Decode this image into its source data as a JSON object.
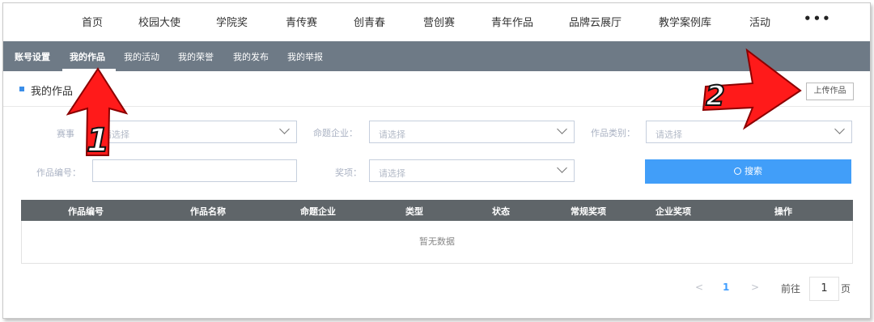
{
  "topnav": {
    "items": [
      "首页",
      "校园大使",
      "学院奖",
      "青传赛",
      "创青春",
      "营创赛",
      "青年作品",
      "品牌云展厅",
      "教学案例库",
      "活动"
    ],
    "more": "•••"
  },
  "subnav": {
    "items": [
      "账号设置",
      "我的作品",
      "我的活动",
      "我的荣誉",
      "我的发布",
      "我的举报"
    ],
    "active": "我的作品"
  },
  "section": {
    "title": "我的作品",
    "upload_label": "上传作品"
  },
  "filters": {
    "contest_label": "赛事",
    "contest_placeholder": "请选择",
    "company_label": "命题企业：",
    "company_placeholder": "请选择",
    "category_label": "作品类别：",
    "category_placeholder": "请选择",
    "work_no_label": "作品编号：",
    "work_no_value": "",
    "award_label": "奖项：",
    "award_placeholder": "请选择",
    "search_label": "搜索"
  },
  "table": {
    "headers": [
      "作品编号",
      "作品名称",
      "命题企业",
      "类型",
      "状态",
      "常规奖项",
      "企业奖项",
      "操作"
    ],
    "empty_text": "暂无数据"
  },
  "pagination": {
    "prev": "<",
    "page": "1",
    "next": ">",
    "goto_label": "前往",
    "goto_value": "1",
    "page_unit": "页"
  },
  "annotations": {
    "arrow1_label": "1",
    "arrow2_label": "2",
    "arrow_color": "#ff1a1a"
  },
  "colors": {
    "subnav_bg": "#6e7a86",
    "search_btn": "#419ef9",
    "table_header": "#5f6569",
    "accent": "#3b8ee8"
  }
}
